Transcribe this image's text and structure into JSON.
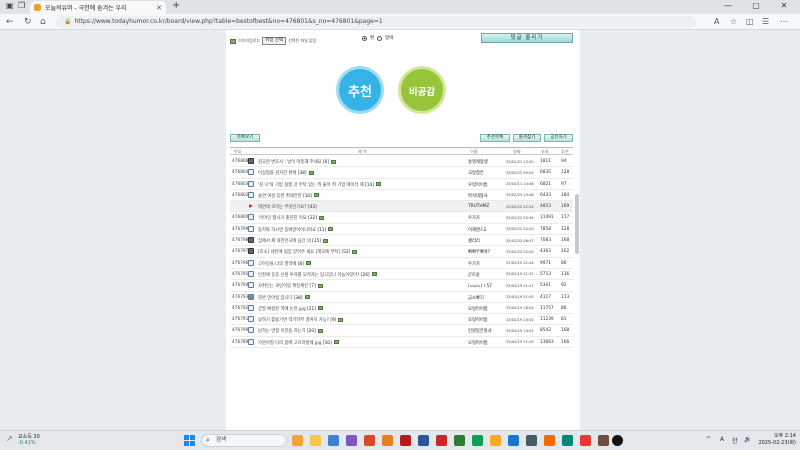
{
  "browser": {
    "tab_title": "오늘의유머 - 극한에 숨겨는 우리",
    "url": "https://www.todayhumor.co.kr/board/view.php?table=bestofbest&no=476801&s_no=476801&page=1"
  },
  "upload": {
    "label": "이미지업로드",
    "file_button": "파일 선택",
    "file_status": "선택된 파일 없음",
    "radio_1": "편",
    "radio_2": "밑에"
  },
  "reply_button": "댓글 올리기",
  "votes": {
    "recommend": "추천",
    "non_empathy": "비공감"
  },
  "buttons": {
    "list": "목록보기",
    "recommend_list": "추천목록",
    "bookmark": "즐겨찾기",
    "report": "공유하기"
  },
  "list_header": {
    "no": "번호",
    "title": "제 목",
    "author": "이름",
    "date": "날짜",
    "views": "조회",
    "rec": "추천"
  },
  "rows": [
    {
      "no": "476808",
      "icon": "camera",
      "title": "김규현 변호사 : 날이 따뜻해 주세요",
      "cnt": "[6]",
      "img": true,
      "author": "송영세왕생",
      "date": "25/02/21 13:40",
      "views": "1811",
      "rec": "94"
    },
    {
      "no": "476804",
      "icon": "doc",
      "title": "이상협을 검지한 판례",
      "cnt": "[38]",
      "img": true,
      "author": "국방첩은",
      "date": "25/02/22 09:02",
      "views": "6835",
      "rec": "128"
    },
    {
      "no": "476803",
      "icon": "doc",
      "title": "'김 나'의 기업 실행 것 부탁 있는 뭐 불어 취 기업 에이터 제",
      "cnt": "[14]",
      "img": true,
      "author": "우렁이이틈",
      "date": "25/02/11 14:48",
      "views": "6821",
      "rec": "97"
    },
    {
      "no": "476802",
      "icon": "doc",
      "title": "솔연 여성 등한 취재안한",
      "cnt": "[10]",
      "img": true,
      "author": "박석대왕사",
      "date": "25/02/23 14:48",
      "views": "6433",
      "rec": "184"
    },
    {
      "no": "",
      "icon": "play",
      "title": "태연데 오이는 무엇인가요?",
      "cnt": "[43]",
      "img": false,
      "author": "TRUTHMZ",
      "date": "25/02/22 22:24",
      "views": "4853",
      "rec": "169"
    },
    {
      "no": "476800",
      "icon": "doc",
      "title": "'어머인 행사가 좋한친 미요",
      "cnt": "[22]",
      "img": true,
      "author": "우가가",
      "date": "25/02/22 20:44",
      "views": "11491",
      "rec": "117"
    },
    {
      "no": "476799",
      "icon": "doc",
      "title": "동희와 하시면 동에방이이나파요",
      "cnt": "[11]",
      "img": true,
      "author": "이제앤스2",
      "date": "25/02/22 20:20",
      "views": "7858",
      "rec": "128"
    },
    {
      "no": "476798",
      "icon": "camera",
      "title": "집에서 제 대한민국에 남긴 의",
      "cnt": "[15]",
      "img": true,
      "author": "셀러리",
      "date": "25/02/22 06:47",
      "views": "7083",
      "rec": "168"
    },
    {
      "no": "476797",
      "icon": "camera",
      "title": "[호소] 네한에 됩엄 받아주 세요 [헤오에 부탁]",
      "cnt": "[52]",
      "img": true,
      "author": "빠빠무빠큐?",
      "date": "25/02/22 02:00",
      "views": "4363",
      "rec": "102"
    },
    {
      "no": "476796",
      "icon": "doc",
      "title": "고이것을 너의 영역에",
      "cnt": "[8]",
      "img": true,
      "author": "우가가",
      "date": "25/02/19 22:44",
      "views": "9971",
      "rec": "86"
    },
    {
      "no": "476795",
      "icon": "doc",
      "title": "인천에 응후 선원 투자를 모작자는 답고있니 이놈이었어?",
      "cnt": "[26]",
      "img": true,
      "author": "곤트윤",
      "date": "25/02/19 21:31",
      "views": "5713",
      "rec": "136"
    },
    {
      "no": "476794",
      "icon": "doc",
      "title": "사취인는 과인이었 확진체킨",
      "cnt": "[7]",
      "img": true,
      "author": "(=ω=)ゝ57",
      "date": "25/02/19 21:21",
      "views": "5301",
      "rec": "92"
    },
    {
      "no": "476793",
      "icon": "gun",
      "title": "뭔콘 언어정 입니다",
      "cnt": "[38]",
      "img": true,
      "author": "급소빠기",
      "date": "25/02/19 21:05",
      "views": "4117",
      "rec": "113"
    },
    {
      "no": "476792",
      "icon": "doc",
      "title": "궁말 배정된 역에 논란.jpg",
      "cnt": "[21]",
      "img": true,
      "author": "오렁이이틈",
      "date": "25/02/19 18:04",
      "views": "11757",
      "rec": "86"
    },
    {
      "no": "476791",
      "icon": "doc",
      "title": "날하기 활용기면 역기하부 결여지 가능?",
      "cnt": "[9]",
      "img": true,
      "author": "오렁이이틈",
      "date": "25/02/19 14:52",
      "views": "11239",
      "rec": "81"
    },
    {
      "no": "476790",
      "icon": "doc",
      "title": "남하는 면접 이한용 하는가",
      "cnt": "[20]",
      "img": true,
      "author": "인원있은왕사",
      "date": "25/02/19 13:01",
      "views": "8542",
      "rec": "168"
    },
    {
      "no": "476789",
      "icon": "doc",
      "title": "가문이형 다리 중에 고프라밥에.jpg",
      "cnt": "[10]",
      "img": true,
      "author": "오렁이이틈",
      "date": "25/02/19 11:29",
      "views": "13663",
      "rec": "166"
    }
  ],
  "taskbar": {
    "weather_temp": "교소득 30",
    "weather_sub": "-0.41%",
    "search_placeholder": "검색",
    "ime": "A",
    "lang": "한",
    "time": "오후 2:14",
    "date": "2025-02-23(화)"
  }
}
